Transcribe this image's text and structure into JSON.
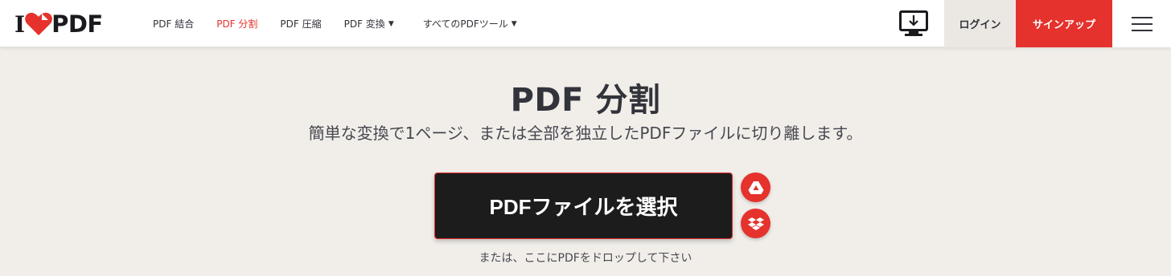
{
  "header": {
    "logo": {
      "prefix": "I",
      "suffix": "PDF"
    },
    "nav": [
      {
        "label": "PDF 結合",
        "active": false
      },
      {
        "label": "PDF 分割",
        "active": true
      },
      {
        "label": "PDF 圧縮",
        "active": false
      },
      {
        "label": "PDF 変換",
        "active": false,
        "dropdown": true
      },
      {
        "label": "すべてのPDFツール",
        "active": false,
        "dropdown": true
      }
    ],
    "desktop_icon": "desktop-download-icon",
    "login_label": "ログイン",
    "signup_label": "サインアップ",
    "menu_icon": "hamburger-menu-icon"
  },
  "hero": {
    "title": "PDF 分割",
    "subtitle": "簡単な変換で1ページ、または全部を独立したPDFファイルに切り離します。",
    "select_button": "PDFファイルを選択",
    "cloud_buttons": [
      "google-drive-icon",
      "dropbox-icon"
    ],
    "drop_hint": "または、ここにPDFをドロップして下さい"
  },
  "colors": {
    "brand_red": "#e5322d",
    "background": "#f1eeea",
    "button_dark": "#1c1c1c",
    "text": "#33333b"
  }
}
